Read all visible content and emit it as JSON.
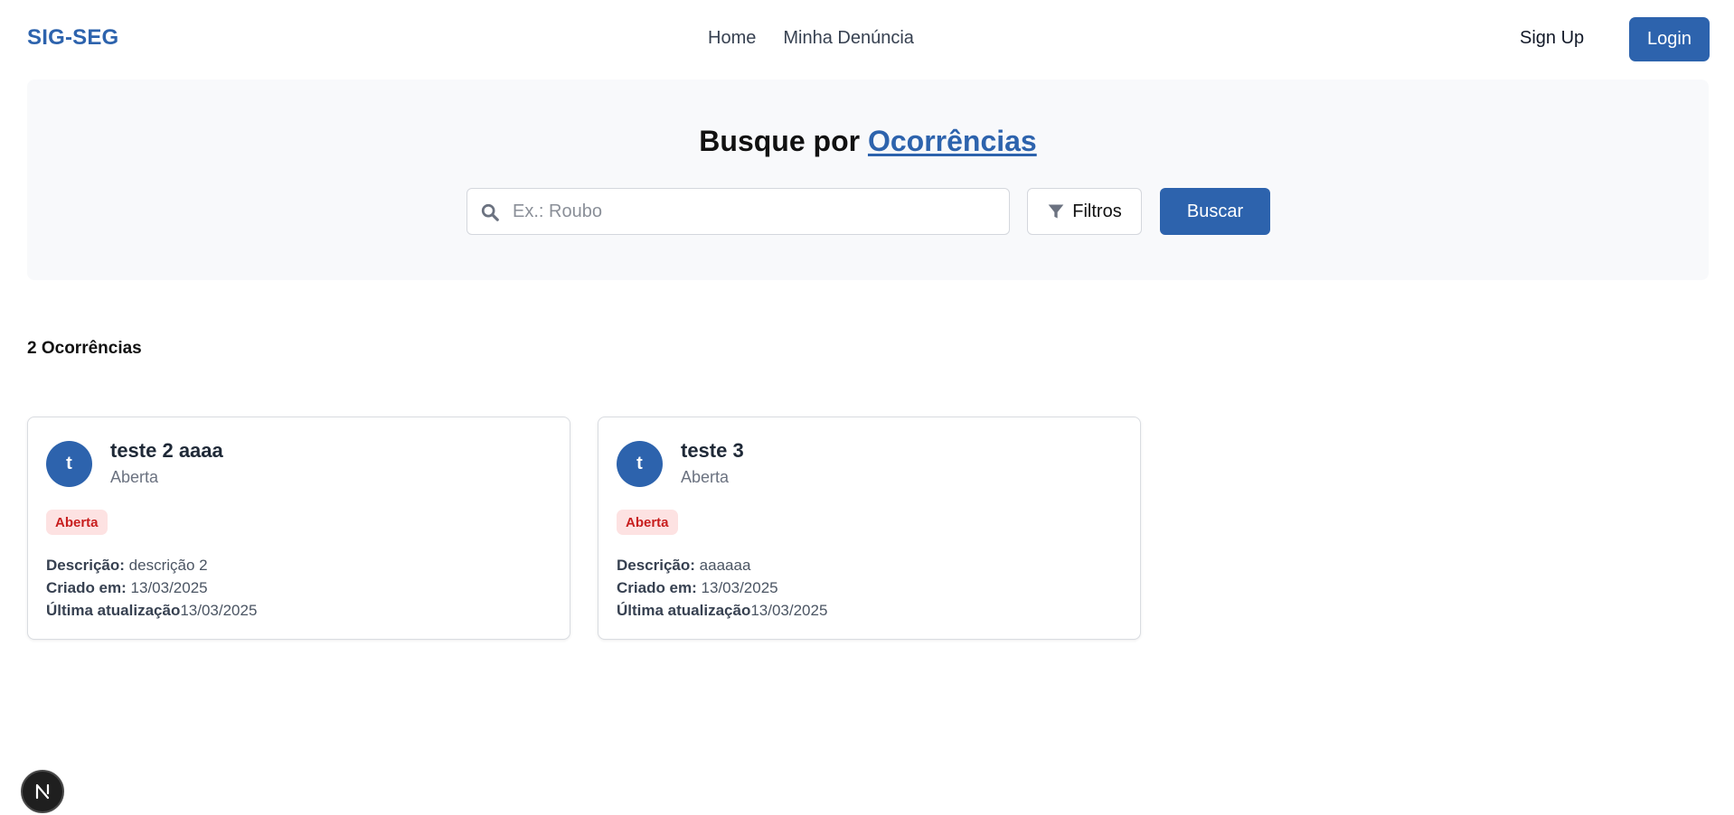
{
  "header": {
    "brand": "SIG-SEG",
    "nav": [
      {
        "label": "Home"
      },
      {
        "label": "Minha Denúncia"
      }
    ],
    "signup_label": "Sign Up",
    "login_label": "Login"
  },
  "hero": {
    "title_prefix": "Busque por",
    "title_accent": "Ocorrências",
    "search_placeholder": "Ex.: Roubo",
    "filters_label": "Filtros",
    "search_button_label": "Buscar"
  },
  "results": {
    "count_label": "2 Ocorrências",
    "cards": [
      {
        "avatar_letter": "t",
        "title": "teste 2 aaaa",
        "subtitle": "Aberta",
        "badge": "Aberta",
        "description_label": "Descrição:",
        "description": "descrição 2",
        "created_label": "Criado em:",
        "created": "13/03/2025",
        "updated_label": "Última atualização",
        "updated": "13/03/2025"
      },
      {
        "avatar_letter": "t",
        "title": "teste 3",
        "subtitle": "Aberta",
        "badge": "Aberta",
        "description_label": "Descrição:",
        "description": "aaaaaa",
        "created_label": "Criado em:",
        "created": "13/03/2025",
        "updated_label": "Última atualização",
        "updated": "13/03/2025"
      }
    ]
  },
  "colors": {
    "primary": "#2d63ad",
    "badge_bg": "#fde2e2",
    "badge_text": "#c81e1e"
  },
  "floating": {
    "icon": "nextjs-n-icon"
  }
}
